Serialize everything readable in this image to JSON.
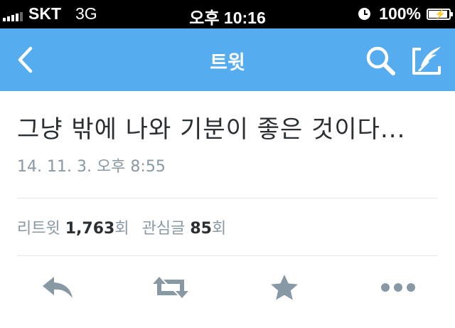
{
  "status_bar": {
    "carrier": "SKT",
    "network": "3G",
    "time": "오후 10:16",
    "battery_percent": "100%",
    "signal_bars_on": 4,
    "signal_bars_total": 5,
    "battery_level": 1.0
  },
  "navbar": {
    "title": "트윗",
    "background": "#55acee",
    "back_icon": "chevron-left-icon",
    "search_icon": "search-icon",
    "compose_icon": "compose-icon"
  },
  "tweet": {
    "text": "그냥 밖에 나와 기분이 좋은 것이다...",
    "timestamp": "14. 11. 3. 오후 8:55"
  },
  "stats": {
    "retweets_label": "리트윗",
    "retweets_count": "1,763",
    "retweets_suffix": "회",
    "favorites_label": "관심글",
    "favorites_count": "85",
    "favorites_suffix": "회"
  },
  "actions": {
    "icon_color": "#8899a6",
    "reply_icon": "reply-icon",
    "retweet_icon": "retweet-icon",
    "favorite_icon": "star-icon",
    "more_icon": "more-icon"
  }
}
